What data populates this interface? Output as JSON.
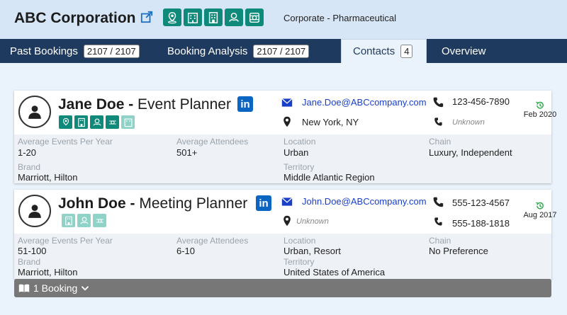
{
  "company": {
    "name": "ABC Corporation",
    "industry": "Corporate - Pharmaceutical",
    "tag_icons": [
      "location-pin-icon",
      "building-icon",
      "hotel-icon",
      "handshake-icon",
      "gear-icon"
    ]
  },
  "tabs": [
    {
      "label": "Past Bookings",
      "count": "2107 / 2107",
      "active": false
    },
    {
      "label": "Booking Analysis",
      "count": "2107 / 2107",
      "active": false
    },
    {
      "label": "Contacts",
      "count": "4",
      "active": true
    },
    {
      "label": "Overview",
      "count": null,
      "active": false
    }
  ],
  "contacts": [
    {
      "name": "Jane Doe",
      "title": "Event Planner",
      "email": "Jane.Doe@ABCcompany.com",
      "location": "New York, NY",
      "phone1": "123-456-7890",
      "phone2": "Unknown",
      "date": "Feb 2020",
      "fields": {
        "avg_events_label": "Average Events Per Year",
        "avg_events": "1-20",
        "avg_attendees_label": "Average Attendees",
        "avg_attendees": "501+",
        "location_label": "Location",
        "location_type": "Urban",
        "chain_label": "Chain",
        "chain": "Luxury, Independent",
        "brand_label": "Brand",
        "brand": "Marriott, Hilton",
        "territory_label": "Territory",
        "territory": "Middle Atlantic Region"
      }
    },
    {
      "name": "John Doe",
      "title": "Meeting Planner",
      "email": "John.Doe@ABCcompany.com",
      "location": "Unknown",
      "phone1": "555-123-4567",
      "phone2": "555-188-1818",
      "date": "Aug 2017",
      "fields": {
        "avg_events_label": "Average Events Per Year",
        "avg_events": "51-100",
        "avg_attendees_label": "Average Attendees",
        "avg_attendees": "6-10",
        "location_label": "Location",
        "location_type": "Urban, Resort",
        "chain_label": "Chain",
        "chain": "No Preference",
        "brand_label": "Brand",
        "brand": "Marriott, Hilton",
        "territory_label": "Territory",
        "territory": "United States of America"
      }
    }
  ],
  "booking_toggle": {
    "label": "1 Booking"
  },
  "colors": {
    "teal": "#0f8a7a",
    "teal_light": "#8fd3c8",
    "nav": "#1f3a5f",
    "linkedin": "#0a66c2",
    "email": "#1a3fc7",
    "green_history": "#2ea84a"
  }
}
